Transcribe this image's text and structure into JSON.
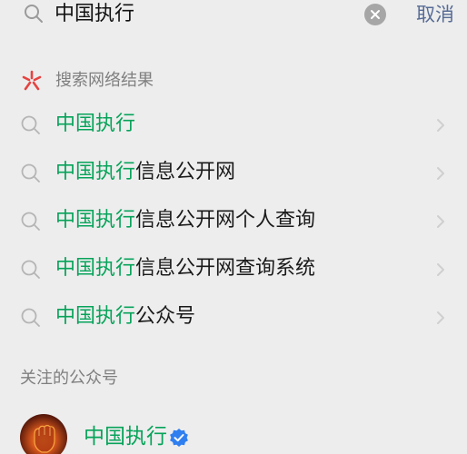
{
  "search": {
    "query": "中国执行",
    "cancel_label": "取消"
  },
  "web_section": {
    "title": "搜索网络结果",
    "suggestions": [
      {
        "highlight": "中国执行",
        "rest": ""
      },
      {
        "highlight": "中国执行",
        "rest": "信息公开网"
      },
      {
        "highlight": "中国执行",
        "rest": "信息公开网个人查询"
      },
      {
        "highlight": "中国执行",
        "rest": "信息公开网查询系统"
      },
      {
        "highlight": "中国执行",
        "rest": "公众号"
      }
    ]
  },
  "followed_section": {
    "title": "关注的公众号",
    "account": {
      "name": "中国执行",
      "verified_icon": "verified-badge-icon"
    }
  },
  "colors": {
    "highlight": "#07a35a",
    "link": "#576b95",
    "verified": "#2f7ff0"
  }
}
